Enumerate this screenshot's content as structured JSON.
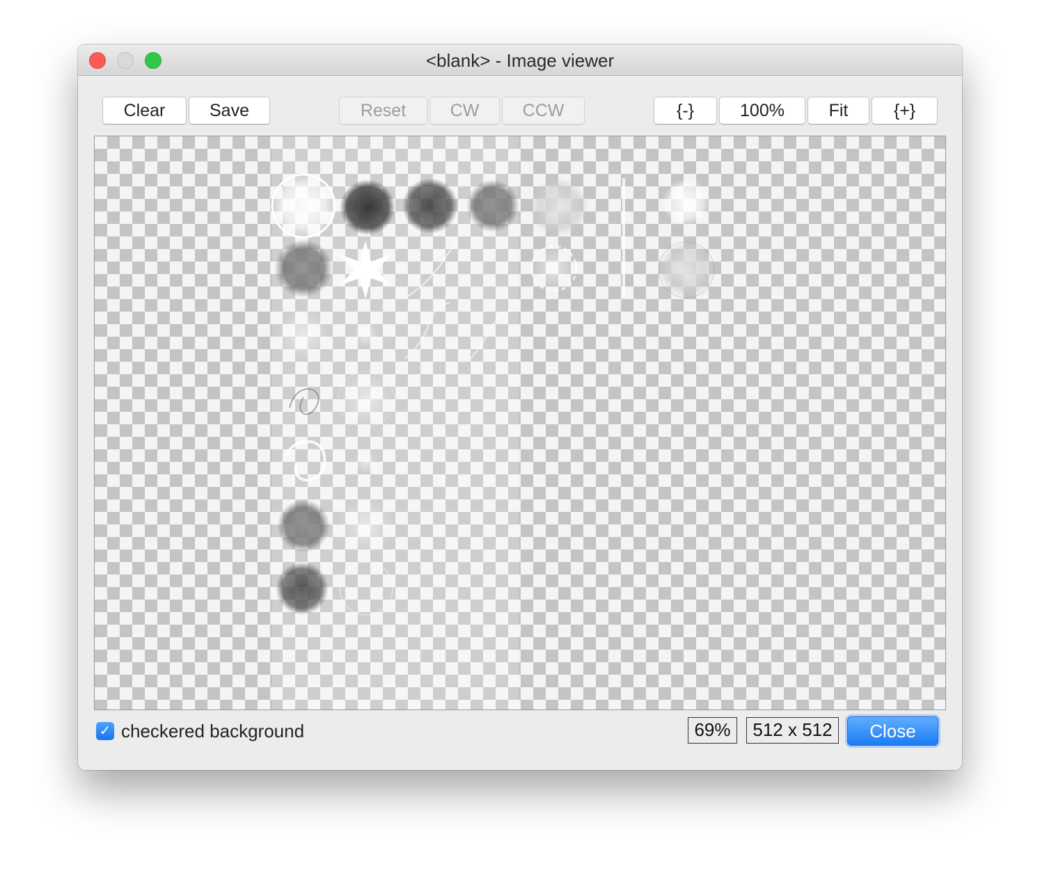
{
  "window": {
    "title": "<blank> - Image viewer"
  },
  "toolbar": {
    "clear_label": "Clear",
    "save_label": "Save",
    "reset_label": "Reset",
    "cw_label": "CW",
    "ccw_label": "CCW",
    "zoom_out_label": "{-}",
    "zoom_100_label": "100%",
    "fit_label": "Fit",
    "zoom_in_label": "{+}"
  },
  "footer": {
    "checkbox_label": "checkered background",
    "checkbox_checked": true,
    "zoom_readout": "69%",
    "size_readout": "512 x 512",
    "close_label": "Close"
  },
  "colors": {
    "close_button": "#1c7cf3",
    "traffic_close": "#fc5b56",
    "traffic_zoom": "#33c748",
    "checker_dark": "#c4c4c4",
    "checker_light": "#f4f4f4"
  }
}
